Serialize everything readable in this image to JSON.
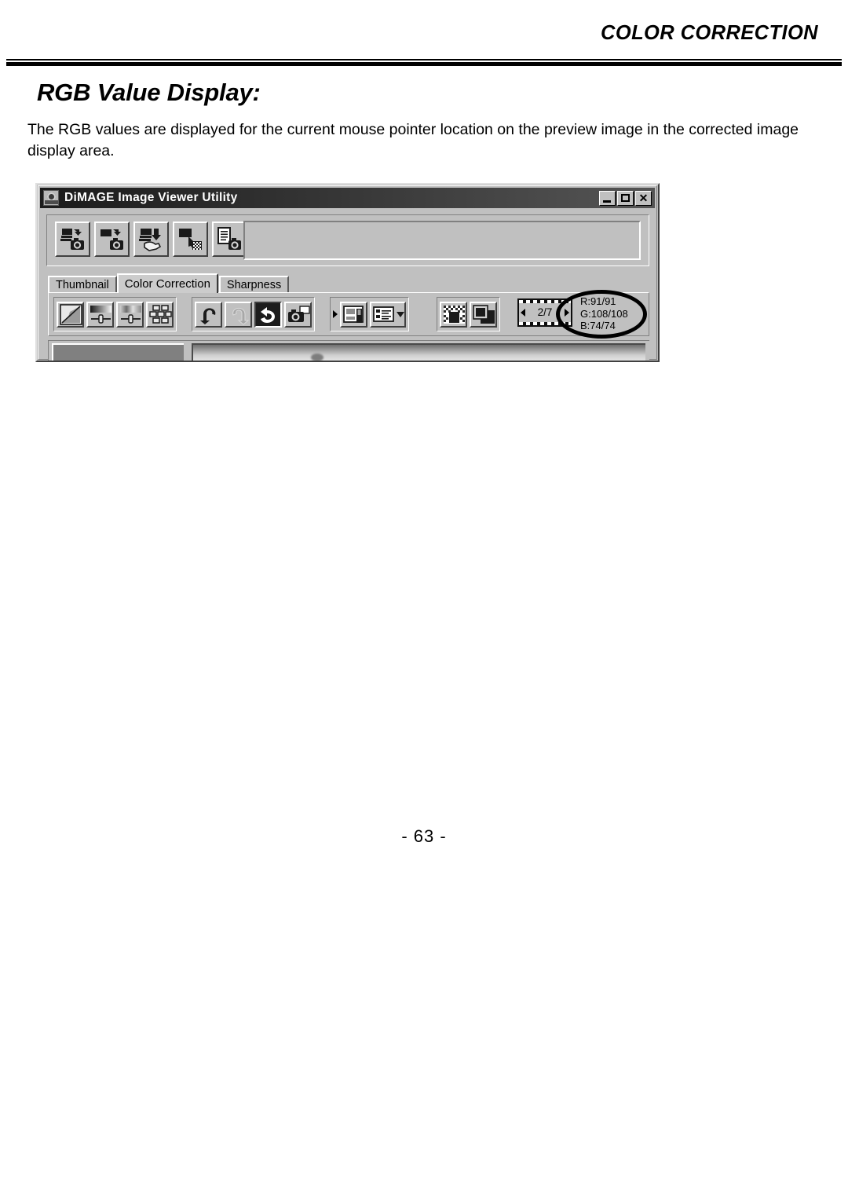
{
  "page": {
    "header_title": "COLOR CORRECTION",
    "section_title": "RGB Value Display:",
    "body_text": "The RGB values are displayed for the current mouse pointer location on the preview image in the corrected image display area.",
    "page_number": "- 63 -"
  },
  "app_window": {
    "title": "DiMAGE Image Viewer Utility",
    "title_icon": "dimage-app-icon",
    "window_buttons": [
      {
        "name": "minimize",
        "glyph": "_"
      },
      {
        "name": "maximize",
        "glyph": "□"
      },
      {
        "name": "close",
        "glyph": "×"
      }
    ],
    "main_toolbar": [
      {
        "name": "load-all-images-button",
        "icon": "load-all-images-icon"
      },
      {
        "name": "load-image-button",
        "icon": "load-image-icon"
      },
      {
        "name": "save-image-button",
        "icon": "save-image-icon"
      },
      {
        "name": "export-image-button",
        "icon": "export-image-icon"
      },
      {
        "name": "print-button",
        "icon": "print-icon"
      }
    ],
    "file_field_value": "",
    "tabs": [
      {
        "label": "Thumbnail",
        "active": false
      },
      {
        "label": "Color Correction",
        "active": true
      },
      {
        "label": "Sharpness",
        "active": false
      }
    ],
    "correction_toolbar": {
      "group1": [
        {
          "name": "tone-curve-histogram-button",
          "icon": "tone-curve-icon"
        },
        {
          "name": "brightness-contrast-balance-button",
          "icon": "brightness-slider-icon"
        },
        {
          "name": "hue-saturation-lightness-button",
          "icon": "hue-slider-icon"
        },
        {
          "name": "variation-button",
          "icon": "variation-grid-icon"
        }
      ],
      "group2": [
        {
          "name": "undo-button",
          "icon": "undo-arrow-icon",
          "state": "enabled"
        },
        {
          "name": "redo-button",
          "icon": "redo-arrow-icon",
          "state": "disabled"
        },
        {
          "name": "reset-all-button",
          "icon": "reset-all-icon",
          "state": "pressed"
        },
        {
          "name": "snapshot-button",
          "icon": "camera-snapshot-icon",
          "state": "enabled"
        }
      ],
      "group3": [
        {
          "name": "save-correction-job-button",
          "icon": "save-job-icon"
        },
        {
          "name": "load-correction-job-button",
          "icon": "load-job-icon"
        }
      ],
      "group4": [
        {
          "name": "display-rgb-values-button",
          "icon": "rgb-values-icon"
        },
        {
          "name": "compare-before-after-button",
          "icon": "compare-images-icon"
        }
      ]
    },
    "frame_navigator": {
      "counter": "2/7",
      "prev_label": "previous-frame",
      "next_label": "next-frame"
    },
    "rgb_readout": {
      "r": "R:91/91",
      "g": "G:108/108",
      "b": "B:74/74"
    },
    "highlight": "rgb-readout-highlight-oval"
  },
  "colors": {
    "window_face": "#c0c0c0",
    "titlebar_dark": "#1b1b1b",
    "highlight_stroke": "#000000",
    "text": "#000000"
  }
}
